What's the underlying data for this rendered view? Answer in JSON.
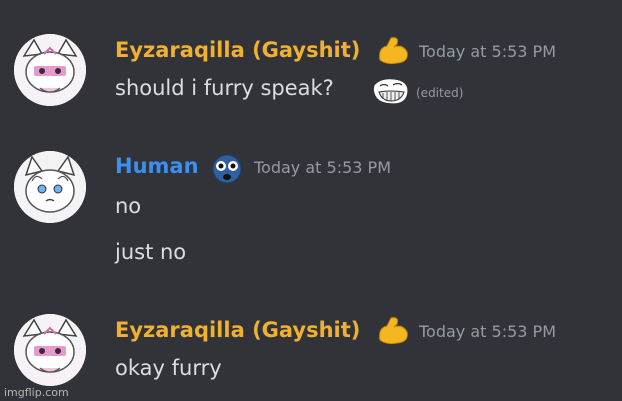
{
  "colors": {
    "background": "#313338",
    "username_user1": "#f0b132",
    "username_user2": "#3b8ff0",
    "timestamp": "#949ba4",
    "message_text": "#dbdee1"
  },
  "messages": [
    {
      "author": "Eyzaraqilla (Gayshit)",
      "badge_icon": "flexed-biceps-emoji",
      "timestamp": "Today at 5:53 PM",
      "lines": [
        "should i furry speak?"
      ],
      "inline_emoji": "trollface-emoji",
      "edited_label": "(edited)"
    },
    {
      "author": "Human",
      "badge_icon": "flushed-face-emoji",
      "timestamp": "Today at 5:53 PM",
      "lines": [
        "no",
        "just no"
      ]
    },
    {
      "author": "Eyzaraqilla (Gayshit)",
      "badge_icon": "flexed-biceps-emoji",
      "timestamp": "Today at 5:53 PM",
      "lines": [
        "okay furry"
      ]
    }
  ],
  "watermark": "imgflip.com"
}
